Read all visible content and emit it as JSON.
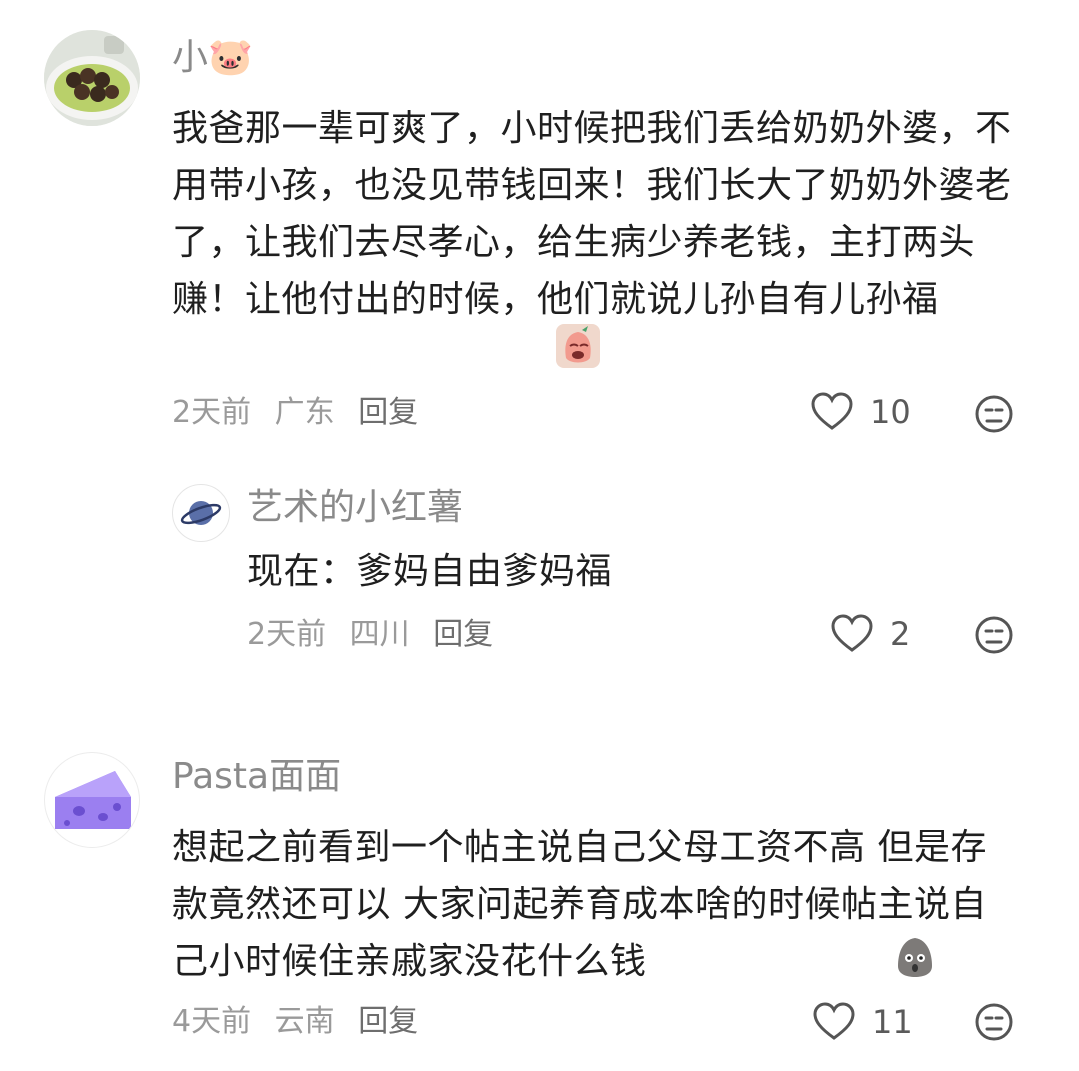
{
  "comments": [
    {
      "username": "小🐷",
      "text": "我爸那一辈可爽了，小时候把我们丢给奶奶外婆，不用带小孩，也没见带钱回来！我们长大了奶奶外婆老了，让我们去尽孝心，给生病少养老钱，主打两头赚！让他付出的时候，他们就说儿孙自有儿孙福",
      "time": "2天前",
      "location": "广东",
      "reply_label": "回复",
      "likes": "10",
      "reply": {
        "username": "艺术的小红薯",
        "text": "现在：爹妈自由爹妈福",
        "time": "2天前",
        "location": "四川",
        "reply_label": "回复",
        "likes": "2"
      }
    },
    {
      "username": "Pasta面面",
      "text": "想起之前看到一个帖主说自己父母工资不高 但是存款竟然还可以 大家问起养育成本啥的时候帖主说自己小时候住亲戚家没花什么钱",
      "time": "4天前",
      "location": "云南",
      "reply_label": "回复",
      "likes": "11"
    }
  ],
  "icons": {
    "like": "heart-outline-icon",
    "react": "neutral-face-icon"
  },
  "colors": {
    "text": "#1f1f1f",
    "meta": "#9a9a9a",
    "icon": "#555555",
    "avatar_cheese": "#9b7ff0"
  }
}
